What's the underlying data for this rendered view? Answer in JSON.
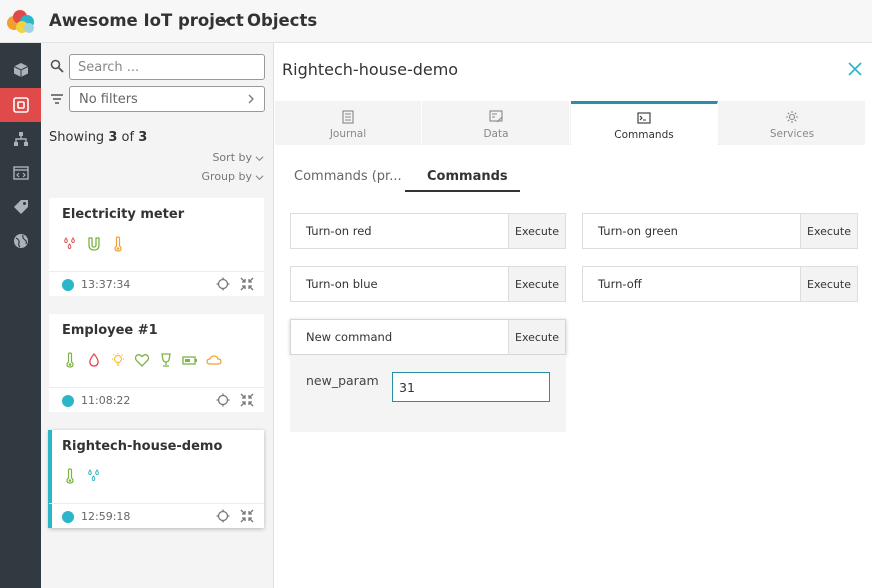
{
  "header": {
    "project_name": "Awesome IoT project",
    "section_title": "Objects"
  },
  "nav": {
    "items": [
      {
        "icon": "cube-icon",
        "active": false
      },
      {
        "icon": "objects-icon",
        "active": true
      },
      {
        "icon": "hierarchy-icon",
        "active": false
      },
      {
        "icon": "code-icon",
        "active": false
      },
      {
        "icon": "tag-icon",
        "active": false
      },
      {
        "icon": "globe-icon",
        "active": false
      }
    ]
  },
  "list": {
    "search_placeholder": "Search ...",
    "filter_text": "No filters",
    "showing_prefix": "Showing",
    "showing_count": "3",
    "showing_of": "of",
    "showing_total": "3",
    "sort_label": "Sort by",
    "group_label": "Group by",
    "objects": [
      {
        "name": "Electricity meter",
        "time": "13:37:34",
        "icons": [
          "drops-icon",
          "magnet-icon",
          "thermometer-icon"
        ],
        "selected": false
      },
      {
        "name": "Employee #1",
        "time": "11:08:22",
        "icons": [
          "thermometer-icon",
          "drop-icon",
          "bulb-icon",
          "heart-icon",
          "cup-icon",
          "battery-icon",
          "cloud-icon"
        ],
        "selected": false
      },
      {
        "name": "Rightech-house-demo",
        "time": "12:59:18",
        "icons": [
          "thermometer-icon",
          "drops-icon"
        ],
        "selected": true
      }
    ]
  },
  "detail": {
    "title": "Rightech-house-demo",
    "tabs": [
      {
        "label": "Journal",
        "icon": "journal-icon",
        "active": false
      },
      {
        "label": "Data",
        "icon": "data-icon",
        "active": false
      },
      {
        "label": "Commands",
        "icon": "terminal-icon",
        "active": true
      },
      {
        "label": "Services",
        "icon": "services-icon",
        "active": false
      }
    ],
    "subtabs": [
      "Commands (pr...",
      "Commands"
    ],
    "commands": [
      {
        "label": "Turn-on red",
        "button": "Execute"
      },
      {
        "label": "Turn-on green",
        "button": "Execute"
      },
      {
        "label": "Turn-on blue",
        "button": "Execute"
      },
      {
        "label": "Turn-off",
        "button": "Execute"
      },
      {
        "label": "New command",
        "button": "Execute"
      }
    ],
    "param": {
      "label": "new_param",
      "value": "31"
    }
  },
  "colors": {
    "accent": "#2ab5c8",
    "tab_active": "#2a8fa3",
    "nav_bg": "#313a40",
    "nav_active": "#e04a4a",
    "sensor_green": "#7cb342",
    "sensor_red": "#e04a4a",
    "sensor_orange": "#f0a030",
    "sensor_blue": "#2ab5c8"
  }
}
